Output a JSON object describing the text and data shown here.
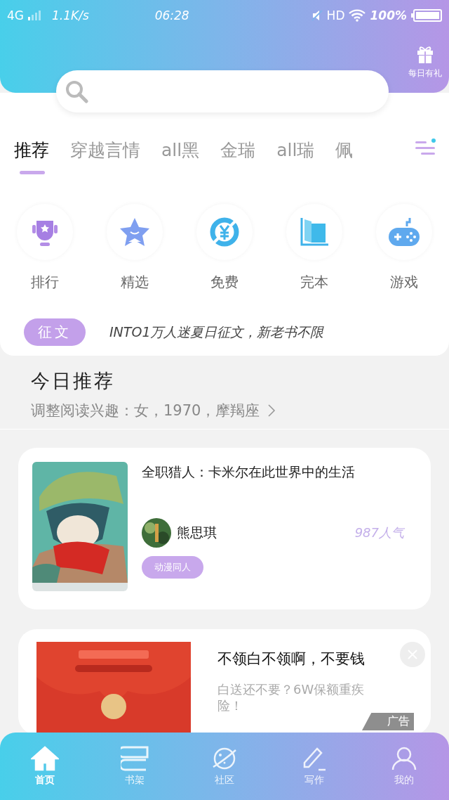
{
  "status_bar": {
    "network": "4G",
    "speed": "1.1K/s",
    "time": "06:28",
    "hd": "HD",
    "battery": "100%"
  },
  "header": {
    "gift_label": "每日有礼"
  },
  "tabs": [
    {
      "label": "推荐",
      "selected": true
    },
    {
      "label": "穿越言情",
      "selected": false
    },
    {
      "label": "all黑",
      "selected": false
    },
    {
      "label": "金瑞",
      "selected": false
    },
    {
      "label": "all瑞",
      "selected": false
    },
    {
      "label": "佩",
      "selected": false
    }
  ],
  "categories": [
    {
      "label": "排行",
      "kind": "trophy"
    },
    {
      "label": "精选",
      "kind": "star"
    },
    {
      "label": "免费",
      "kind": "free"
    },
    {
      "label": "完本",
      "kind": "book"
    },
    {
      "label": "游戏",
      "kind": "game"
    }
  ],
  "notice": {
    "tag": "征文",
    "text": "INTO1万人迷夏日征文，新老书不限"
  },
  "section": {
    "title": "今日推荐",
    "subtitle": "调整阅读兴趣：女，1970，摩羯座"
  },
  "book": {
    "title": "全职猎人：卡米尔在此世界中的生活",
    "author": "熊思琪",
    "popularity": "987人气",
    "tag": "动漫同人"
  },
  "ad": {
    "title": "不领白不领啊，不要钱",
    "description": "白送还不要？6W保额重疾险！",
    "label": "广告"
  },
  "bottom_nav": [
    {
      "label": "首页",
      "kind": "home",
      "selected": true
    },
    {
      "label": "书架",
      "kind": "shelf",
      "selected": false
    },
    {
      "label": "社区",
      "kind": "planet",
      "selected": false
    },
    {
      "label": "写作",
      "kind": "pen",
      "selected": false
    },
    {
      "label": "我的",
      "kind": "person",
      "selected": false
    }
  ]
}
